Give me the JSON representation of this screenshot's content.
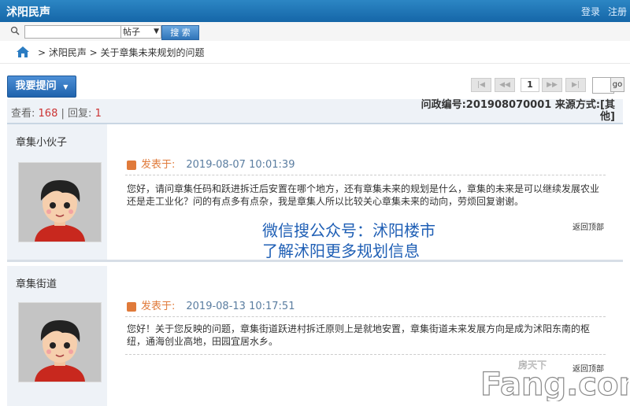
{
  "header": {
    "site_name": "沭阳民声",
    "login": "登录",
    "register": "注册"
  },
  "search": {
    "query": "",
    "type_selected": "帖子",
    "button": "搜 索"
  },
  "breadcrumb": {
    "text": "> 沭阳民声 > 关于章集未来规划的问题"
  },
  "toolbar": {
    "ask_button": "我要提问",
    "pager": {
      "first": "|◀",
      "prev": "◀◀",
      "current": "1",
      "next": "▶▶",
      "last": "▶|",
      "go": "go"
    }
  },
  "thread": {
    "views_label": "查看:",
    "views": "168",
    "separator": "|",
    "replies_label": "回复:",
    "replies": "1",
    "case_no": "问政编号:201908070001 来源方式:[其他]"
  },
  "posts": [
    {
      "author": "章集小伙子",
      "posted_label": "发表于:",
      "time": "2019-08-07 10:01:39",
      "content": "您好，请问章集任码和跃进拆迁后安置在哪个地方，还有章集未来的规划是什么，章集的未来是可以继续发展农业还是走工业化？问的有点多有点杂，我是章集人所以比较关心章集未来的动向，劳烦回复谢谢。",
      "back_to_top": "返回顶部"
    },
    {
      "author": "章集街道",
      "posted_label": "发表于:",
      "time": "2019-08-13 10:17:51",
      "content": "您好！关于您反映的问题，章集街道跃进村拆迁原则上是就地安置，章集街道未来发展方向是成为沭阳东南的枢纽，通海创业高地，田园宜居水乡。",
      "back_to_top": "返回顶部"
    }
  ],
  "promo": {
    "line1": "微信搜公众号：沭阳楼市",
    "line2": "了解沭阳更多规划信息"
  },
  "watermark": {
    "brand": "Fang.com",
    "chinese": "房天下"
  },
  "colors": {
    "header": "#1f72b4",
    "accent": "#e07a3a",
    "count": "#cc3333",
    "link": "#1f5fb5"
  }
}
